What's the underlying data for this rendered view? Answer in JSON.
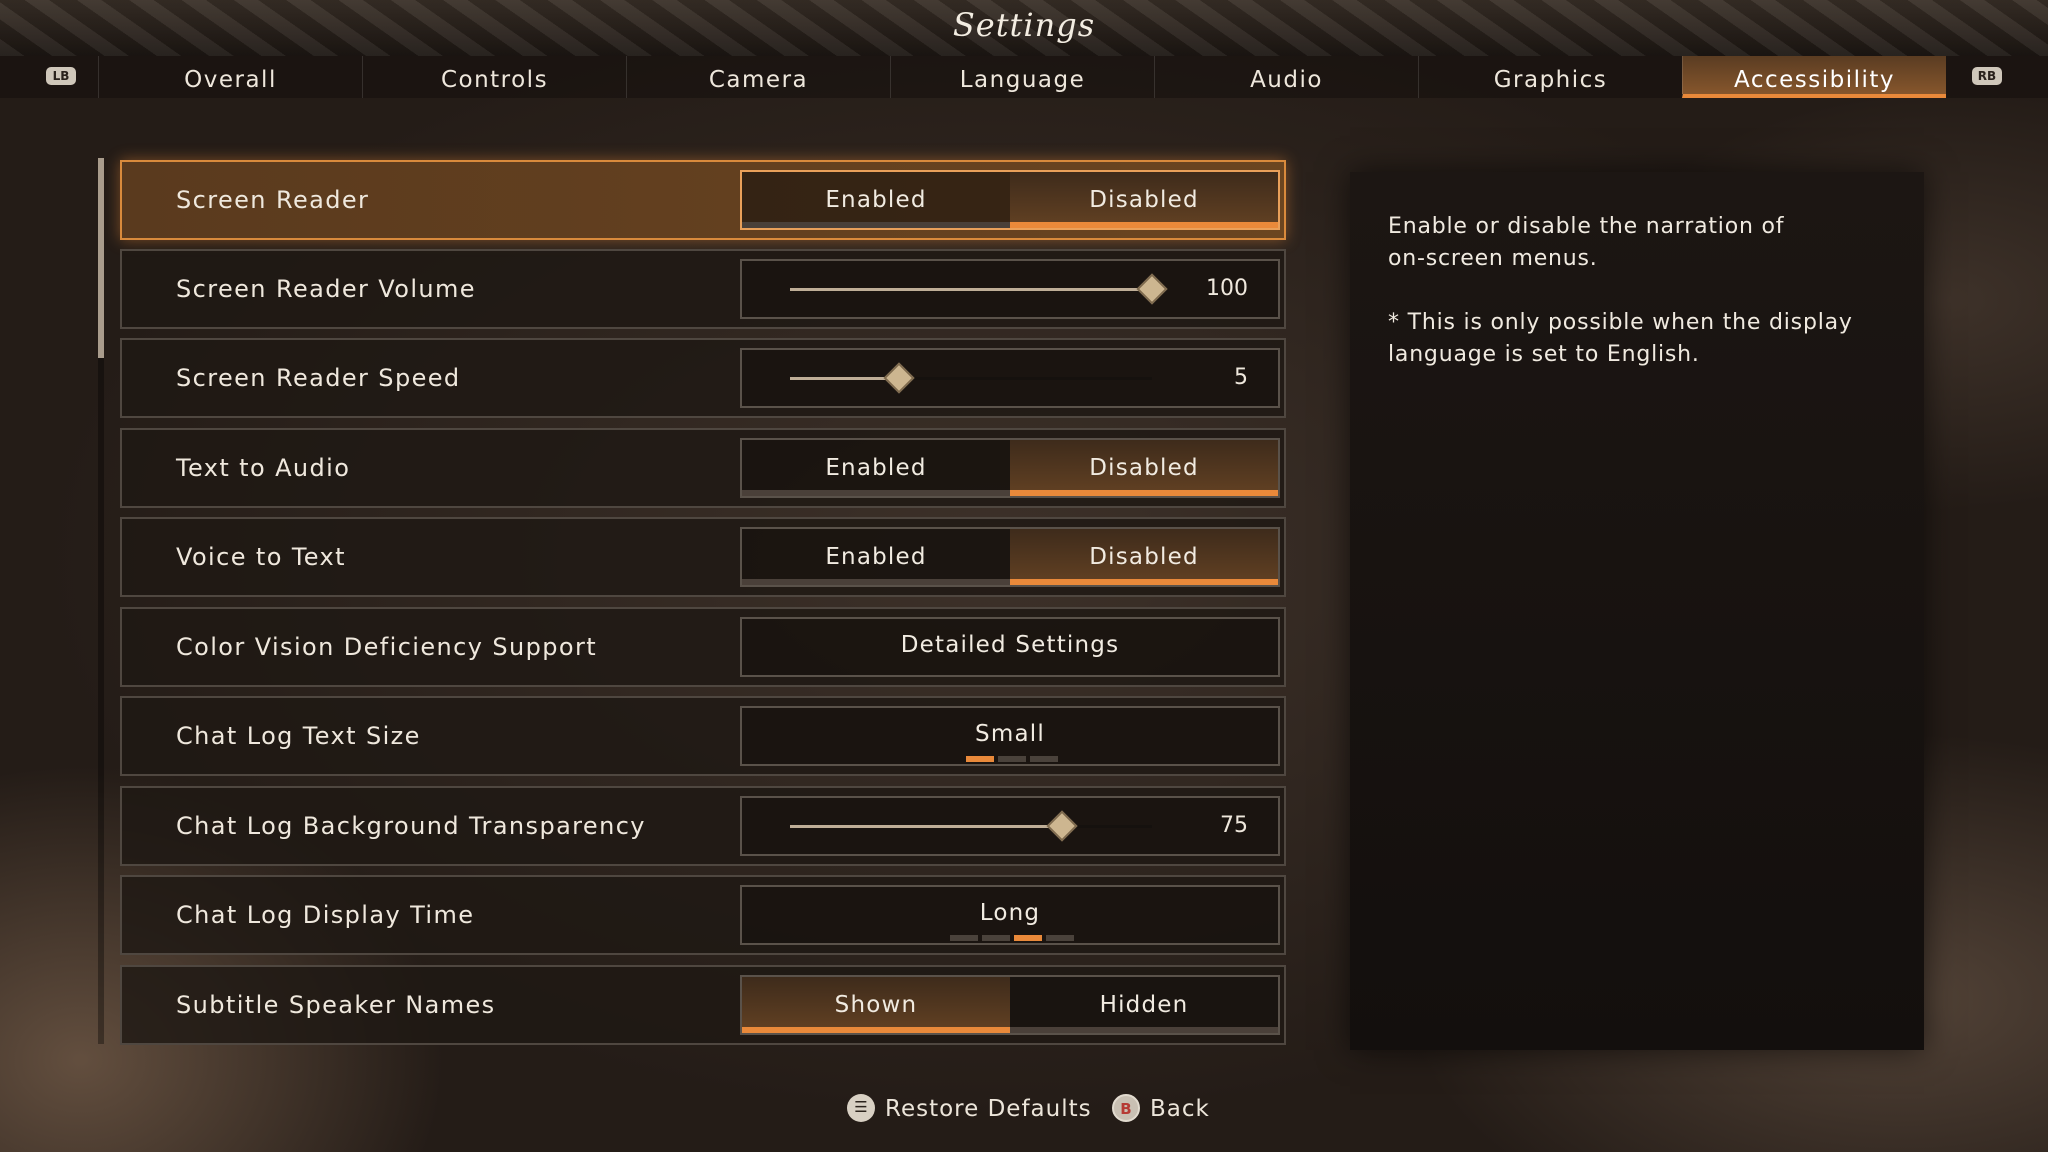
{
  "header": {
    "title": "Settings",
    "lb": "LB",
    "rb": "RB"
  },
  "tabs": [
    {
      "label": "Overall",
      "active": false
    },
    {
      "label": "Controls",
      "active": false
    },
    {
      "label": "Camera",
      "active": false
    },
    {
      "label": "Language",
      "active": false
    },
    {
      "label": "Audio",
      "active": false
    },
    {
      "label": "Graphics",
      "active": false
    },
    {
      "label": "Accessibility",
      "active": true
    }
  ],
  "settings": {
    "screen_reader": {
      "label": "Screen Reader",
      "options": [
        "Enabled",
        "Disabled"
      ],
      "selected": "Disabled"
    },
    "screen_reader_volume": {
      "label": "Screen Reader Volume",
      "value": "100",
      "min": 0,
      "max": 100,
      "level": 100
    },
    "screen_reader_speed": {
      "label": "Screen Reader Speed",
      "value": "5",
      "min": 0,
      "max": 10,
      "level": 3
    },
    "text_to_audio": {
      "label": "Text to Audio",
      "options": [
        "Enabled",
        "Disabled"
      ],
      "selected": "Disabled"
    },
    "voice_to_text": {
      "label": "Voice to Text",
      "options": [
        "Enabled",
        "Disabled"
      ],
      "selected": "Disabled"
    },
    "color_vision": {
      "label": "Color Vision Deficiency Support",
      "button": "Detailed Settings"
    },
    "chat_log_text_size": {
      "label": "Chat Log Text Size",
      "value": "Small",
      "step": 1,
      "steps": 3
    },
    "chat_log_bg_transparency": {
      "label": "Chat Log Background Transparency",
      "value": "75",
      "min": 0,
      "max": 100,
      "level": 75
    },
    "chat_log_display_time": {
      "label": "Chat Log Display Time",
      "value": "Long",
      "step": 3,
      "steps": 4
    },
    "subtitle_speaker_names": {
      "label": "Subtitle Speaker Names",
      "options": [
        "Shown",
        "Hidden"
      ],
      "selected": "Shown"
    }
  },
  "description": {
    "line1": "Enable or disable the narration of",
    "line2": "on-screen menus.",
    "line3": "* This is only possible when the display",
    "line4": "language is set to English."
  },
  "footer": {
    "restore_defaults": "Restore Defaults",
    "back": "Back",
    "b_glyph": "B"
  },
  "colors": {
    "accent": "#e9893a",
    "selected_row": "#6b4520"
  },
  "icons": {
    "menu": "menu-button-icon",
    "b": "b-button-icon"
  }
}
